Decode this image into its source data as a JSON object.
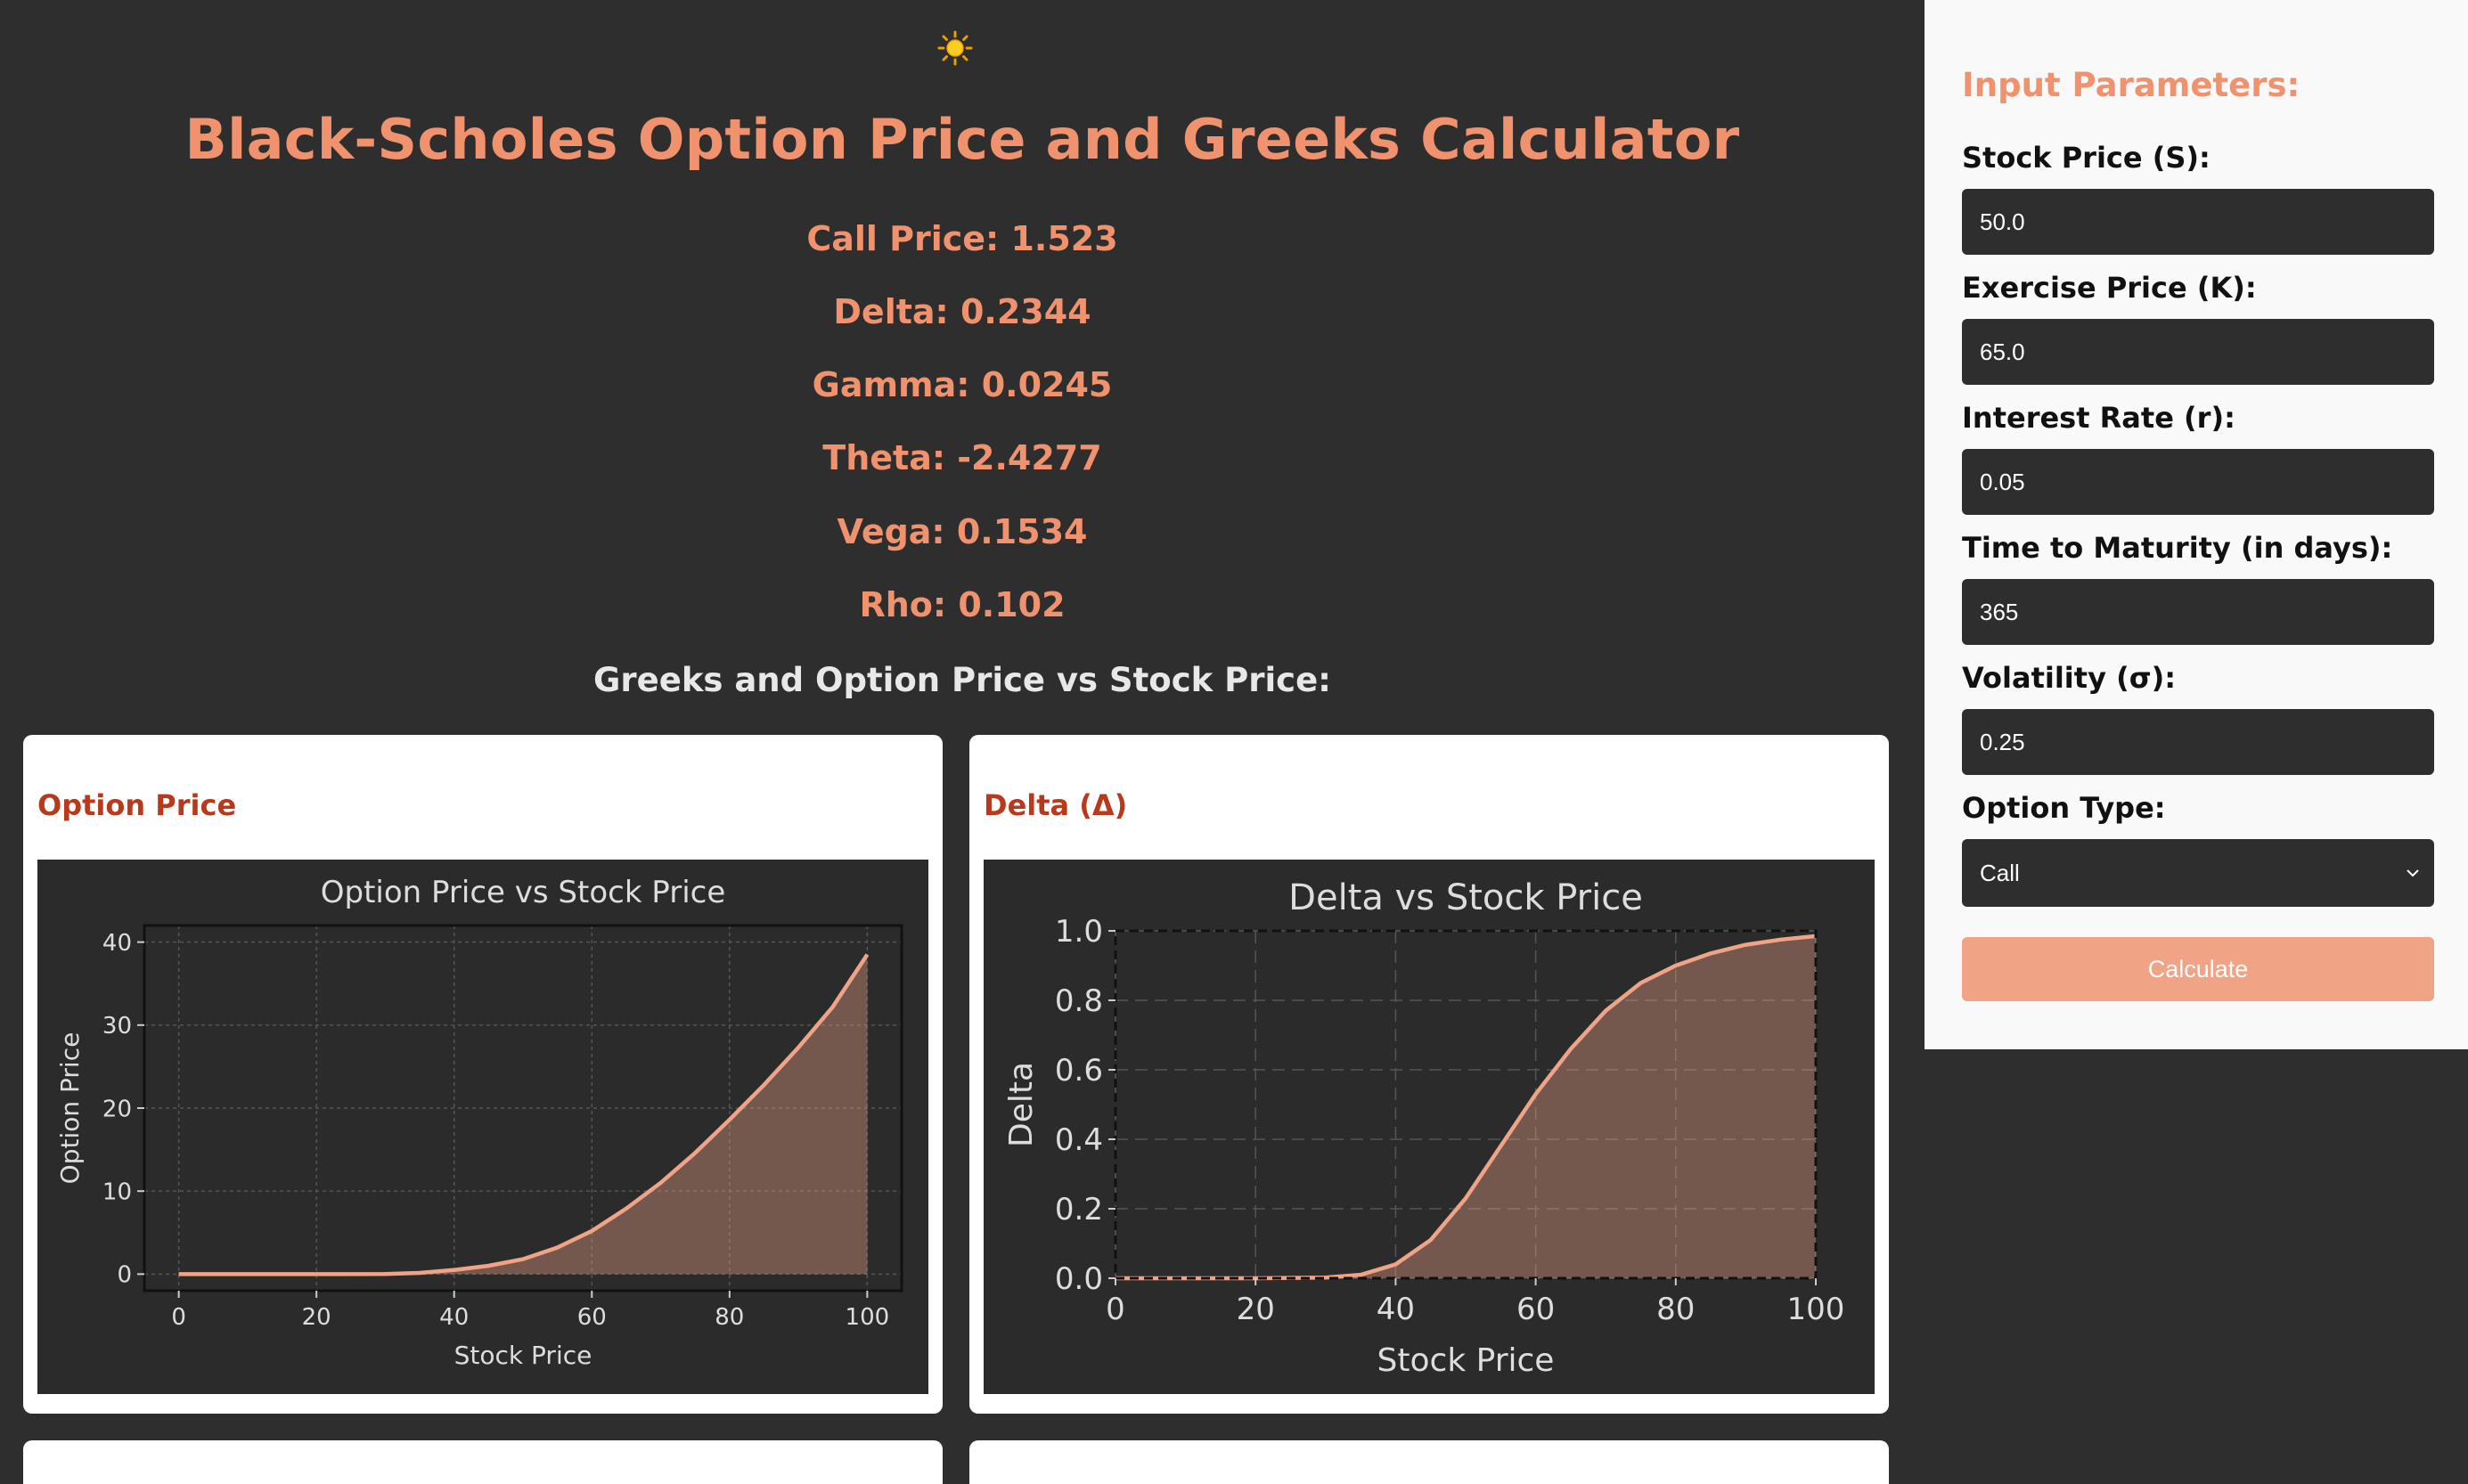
{
  "header": {
    "theme_icon": "sun-icon",
    "title": "Black-Scholes Option Price and Greeks Calculator"
  },
  "results": [
    "Call Price: 1.523",
    "Delta: 0.2344",
    "Gamma: 0.0245",
    "Theta: -2.4277",
    "Vega: 0.1534",
    "Rho: 0.102"
  ],
  "section_title": "Greeks and Option Price vs Stock Price:",
  "cards": [
    {
      "title": "Option Price"
    },
    {
      "title": "Delta (Δ)"
    }
  ],
  "sidebar": {
    "heading": "Input Parameters:",
    "fields": [
      {
        "label": "Stock Price (S):",
        "value": "50.0"
      },
      {
        "label": "Exercise Price (K):",
        "value": "65.0"
      },
      {
        "label": "Interest Rate (r):",
        "value": "0.05"
      },
      {
        "label": "Time to Maturity (in days):",
        "value": "365"
      },
      {
        "label": "Volatility (σ):",
        "value": "0.25"
      }
    ],
    "option_type": {
      "label": "Option Type:",
      "value": "Call"
    },
    "calculate_label": "Calculate"
  },
  "colors": {
    "accent": "#f0926d",
    "card_title": "#b8391c",
    "button": "#f0a385",
    "background": "#2e2e2e"
  },
  "chart_data": [
    {
      "type": "area",
      "title": "Option Price vs Stock Price",
      "xlabel": "Stock Price",
      "ylabel": "Option Price",
      "xlim": [
        0,
        100
      ],
      "ylim": [
        0,
        40
      ],
      "xticks": [
        0,
        20,
        40,
        60,
        80,
        100
      ],
      "yticks": [
        0,
        10,
        20,
        30,
        40
      ],
      "grid": true,
      "x": [
        0,
        10,
        20,
        30,
        35,
        40,
        45,
        50,
        55,
        60,
        65,
        70,
        75,
        80,
        85,
        90,
        95,
        100
      ],
      "y": [
        0,
        0,
        0,
        0.02,
        0.15,
        0.5,
        1.0,
        1.8,
        3.2,
        5.2,
        7.9,
        11.0,
        14.6,
        18.6,
        22.8,
        27.3,
        32.2,
        38.5
      ]
    },
    {
      "type": "area",
      "title": "Delta vs Stock Price",
      "xlabel": "Stock Price",
      "ylabel": "Delta",
      "xlim": [
        0,
        100
      ],
      "ylim": [
        0,
        1
      ],
      "xticks": [
        0,
        20,
        40,
        60,
        80,
        100
      ],
      "yticks": [
        0.0,
        0.2,
        0.4,
        0.6,
        0.8,
        1.0
      ],
      "grid": true,
      "x": [
        0,
        10,
        20,
        30,
        35,
        40,
        45,
        50,
        55,
        60,
        65,
        70,
        75,
        80,
        85,
        90,
        95,
        100
      ],
      "y": [
        0,
        0,
        0,
        0.002,
        0.01,
        0.04,
        0.11,
        0.23,
        0.38,
        0.53,
        0.66,
        0.77,
        0.85,
        0.9,
        0.935,
        0.96,
        0.975,
        0.985
      ]
    }
  ]
}
